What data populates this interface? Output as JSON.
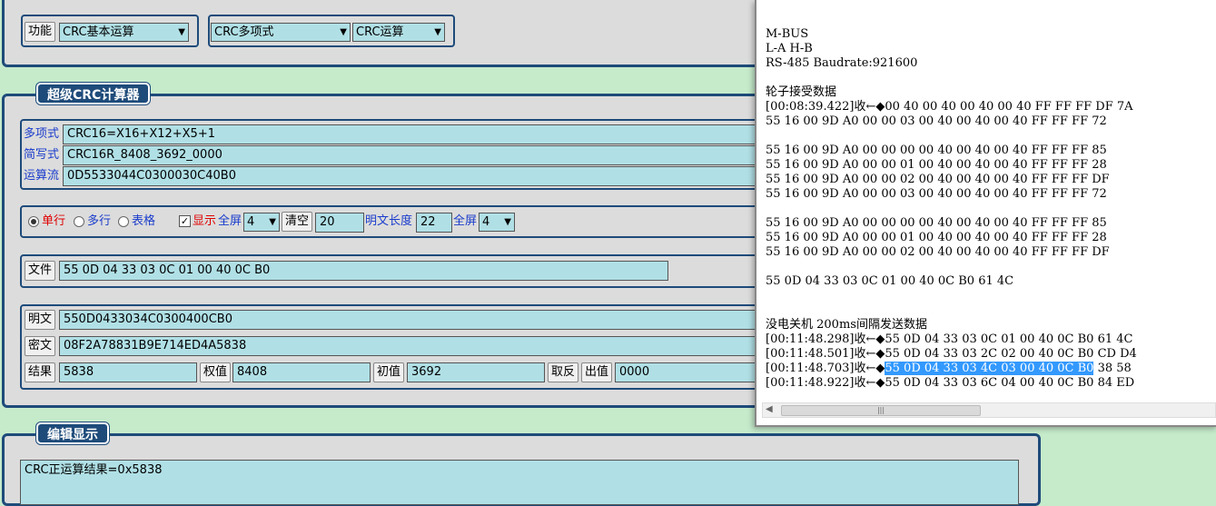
{
  "top": {
    "func_button": "功能",
    "func_select": "CRC基本运算",
    "poly_select": "CRC多项式",
    "op_select": "CRC运算"
  },
  "calc": {
    "legend": "超级CRC计算器",
    "rows": [
      {
        "label": "多项式",
        "value": "CRC16=X16+X12+X5+1"
      },
      {
        "label": "简写式",
        "value": "CRC16R_8408_3692_0000"
      },
      {
        "label": "运算流",
        "value": "0D5533044C0300030C40B0"
      }
    ],
    "options": {
      "single_line": "单行",
      "multi_line": "多行",
      "table": "表格",
      "show": "显示",
      "fullscreen": "全屏",
      "fullscreen_select": "4",
      "clear_button": "清空",
      "clear_value": "20",
      "plain_len_label": "明文长度",
      "plain_len_value": "22",
      "fullscreen2": "全屏",
      "fullscreen2_select": "4"
    },
    "file": {
      "button": "文件",
      "value": "55 0D 04 33 03 0C 01 00 40 0C B0"
    },
    "plain": {
      "button": "明文",
      "value": "550D0433034C0300400CB0"
    },
    "cipher": {
      "button": "密文",
      "value": "08F2A78831B9E714ED4A5838"
    },
    "result_row": {
      "result_button": "结果",
      "result_value": "5838",
      "weight_button": "权值",
      "weight_value": "8408",
      "init_button": "初值",
      "init_value": "3692",
      "invert_button": "取反",
      "out_button": "出值",
      "out_value": "0000"
    }
  },
  "edit": {
    "legend": "编辑显示",
    "text": "CRC正运算结果=0x5838"
  },
  "console": {
    "lines_top": "M-BUS\nL-A H-B\nRS-485 Baudrate:921600\n\n轮子接受数据\n[00:08:39.422]收←◆00 40 00 40 00 40 00 40 FF FF FF DF 7A\n55 16 00 9D A0 00 00 03 00 40 00 40 00 40 FF FF FF 72\n\n55 16 00 9D A0 00 00 00 00 40 00 40 00 40 FF FF FF 85\n55 16 00 9D A0 00 00 01 00 40 00 40 00 40 FF FF FF 28\n55 16 00 9D A0 00 00 02 00 40 00 40 00 40 FF FF FF DF\n55 16 00 9D A0 00 00 03 00 40 00 40 00 40 FF FF FF 72\n\n55 16 00 9D A0 00 00 00 00 40 00 40 00 40 FF FF FF 85\n55 16 00 9D A0 00 00 01 00 40 00 40 00 40 FF FF FF 28\n55 16 00 9D A0 00 00 02 00 40 00 40 00 40 FF FF FF DF\n\n55 0D 04 33 03 0C 01 00 40 0C B0 61 4C\n\n\n没电关机 200ms间隔发送数据\n[00:11:48.298]收←◆55 0D 04 33 03 0C 01 00 40 0C B0 61 4C\n[00:11:48.501]收←◆55 0D 04 33 03 2C 02 00 40 0C B0 CD D4",
    "hl_prefix": "[00:11:48.703]收←◆",
    "hl_text": "55 0D 04 33 03 4C 03 00 40 0C B0",
    "hl_suffix": " 38 58",
    "last_line": "[00:11:48.922]收←◆55 0D 04 33 03 6C 04 00 40 0C B0 84 ED"
  },
  "colors": {
    "panel_border": "#1e4b7a",
    "field_bg": "#b0e0e6",
    "page_bg": "#c5ebcb",
    "highlight": "#3399ff"
  }
}
